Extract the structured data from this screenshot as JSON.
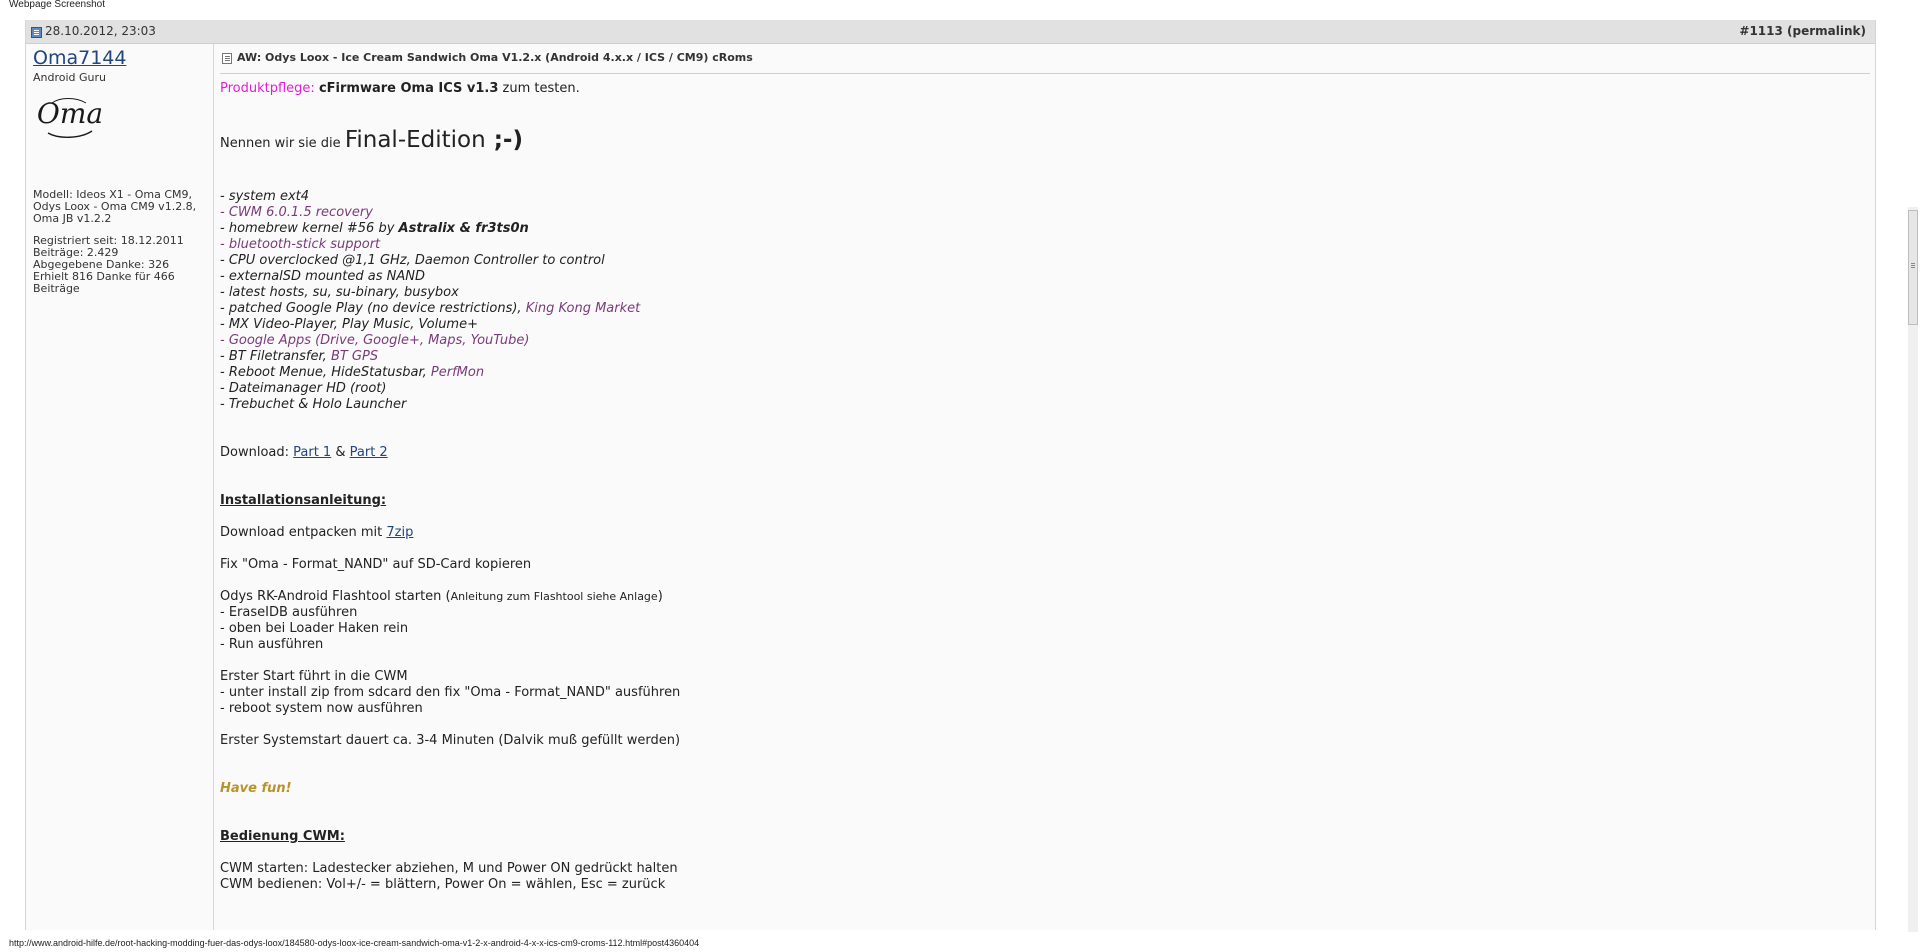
{
  "page_label": "Webpage Screenshot",
  "post": {
    "date": "28.10.2012, 23:03",
    "number": "#1113",
    "permalink": "permalink",
    "title": "AW: Odys Loox - Ice Cream Sandwich Oma V1.2.x (Android 4.x.x / ICS / CM9) cRoms"
  },
  "user": {
    "name": "Oma7144",
    "title": "Android Guru",
    "avatar_text": "Oma",
    "model_line1": "Modell: Ideos X1 - Oma CM9,",
    "model_line2": "Odys Loox - Oma CM9 v1.2.8,",
    "model_line3": "Oma JB v1.2.2",
    "registered": "Registriert seit: 18.12.2011",
    "posts": "Beiträge: 2.429",
    "thanks_given": "Abgegebene Danke: 326",
    "thanks_received_line1": "Erhielt 816 Danke für 466",
    "thanks_received_line2": "Beiträge"
  },
  "content": {
    "produkt_label": "Produktpflege:",
    "produkt_bold": "cFirmware Oma ICS v1.3",
    "produkt_rest": " zum testen.",
    "nennen": "Nennen wir sie die ",
    "final": "Final-Edition",
    "wink": " ;-)",
    "features": {
      "f1": "- system ext4",
      "f2": "- CWM 6.0.1.5 recovery",
      "f3a": "- homebrew kernel #56 by ",
      "f3b": "Astralix & fr3ts0n",
      "f4": "- bluetooth-stick support",
      "f5": "- CPU overclocked @1,1 GHz, Daemon Controller to control",
      "f6": "- externalSD mounted as NAND",
      "f7": "- latest hosts, su, su-binary, busybox",
      "f8a": "- patched Google Play (no device restrictions), ",
      "f8b": "King Kong Market",
      "f9": "- MX Video-Player, Play Music, Volume+",
      "f10": "- Google Apps (Drive, Google+, Maps, YouTube)",
      "f11a": "- BT Filetransfer, ",
      "f11b": "BT GPS",
      "f12a": "- Reboot Menue, HideStatusbar, ",
      "f12b": "PerfMon",
      "f13": "- Dateimanager HD (root)",
      "f14": "- Trebuchet & Holo Launcher"
    },
    "download_label": "Download: ",
    "part1": "Part 1",
    "amp": " & ",
    "part2": "Part 2",
    "install_heading": "Installationsanleitung:",
    "entpacken": "Download entpacken mit ",
    "zip": "7zip",
    "fix_copy": "Fix \"Oma - Format_NAND\" auf SD-Card kopieren",
    "flash_start": "Odys RK-Android Flashtool starten (",
    "flash_small": "Anleitung zum Flashtool siehe Anlage",
    "flash_close": ")",
    "erase": "- EraseIDB ausführen",
    "loader": "- oben bei Loader Haken rein",
    "run": "- Run ausführen",
    "erster_start": "Erster Start führt in die CWM",
    "unter": "- unter install zip from sdcard den fix \"Oma - Format_NAND\" ausführen",
    "reboot": "- reboot system now ausführen",
    "systemstart": "Erster Systemstart dauert ca. 3-4 Minuten (Dalvik muß gefüllt werden)",
    "have_fun": "Have fun!",
    "bedienung_heading": "Bedienung CWM:",
    "cwm_start": "CWM starten: Ladestecker abziehen, M und Power ON gedrückt halten",
    "cwm_bedienen": "CWM bedienen: Vol+/- = blättern, Power On = wählen, Esc = zurück"
  },
  "status_url": "http://www.android-hilfe.de/root-hacking-modding-fuer-das-odys-loox/184580-odys-loox-ice-cream-sandwich-oma-v1-2-x-android-4-x-x-ics-cm9-croms-112.html#post4360404"
}
